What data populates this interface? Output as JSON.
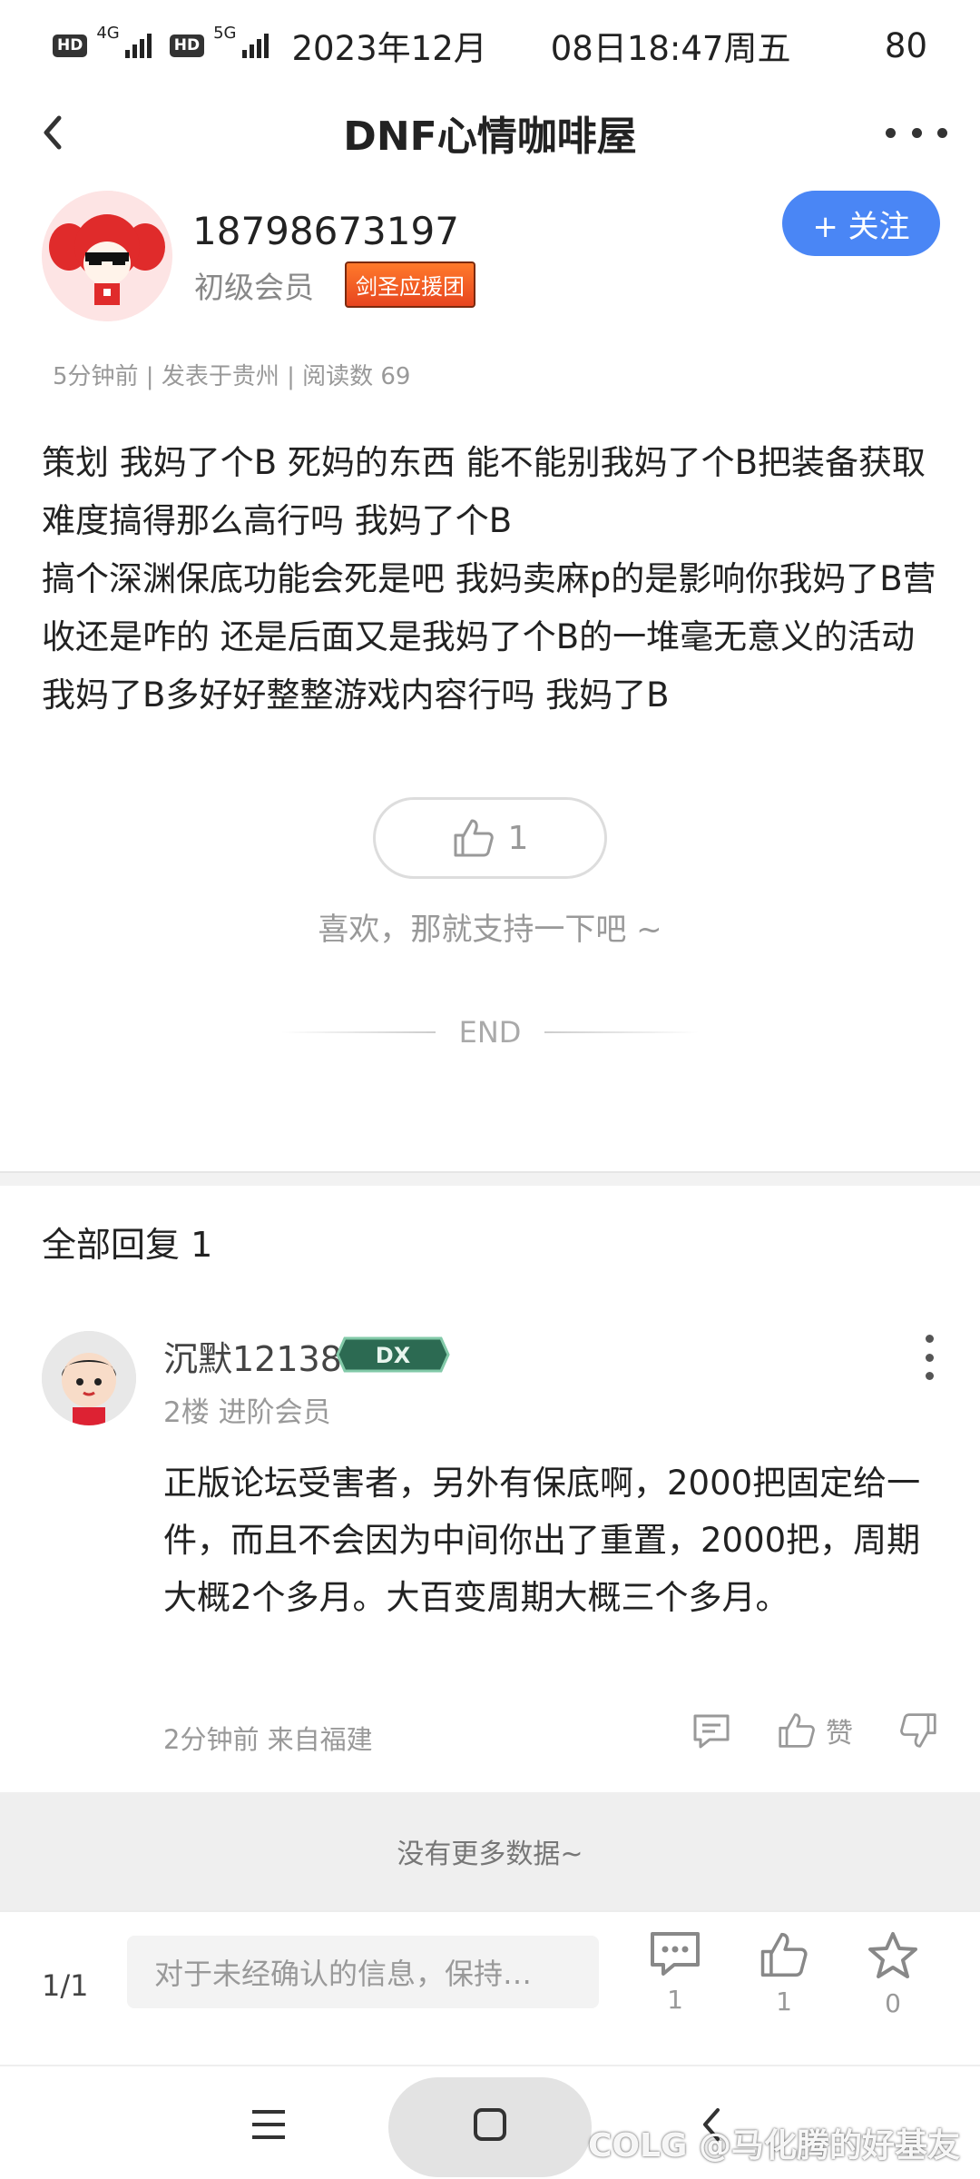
{
  "status_bar": {
    "hd1": "HD",
    "net1": "4G",
    "hd2": "HD",
    "net2": "5G",
    "date": "2023年12月",
    "time": "08日18:47周五",
    "battery": "80"
  },
  "header": {
    "title": "DNF心情咖啡屋",
    "back_icon": "chevron-left-icon",
    "more_icon": "more-horizontal-icon"
  },
  "author": {
    "name": "18798673197",
    "level": "初级会员",
    "badge": "剑圣应援团",
    "follow_label": "+ 关注"
  },
  "post": {
    "meta": "5分钟前 | 发表于贵州 | 阅读数 69",
    "body": "策划 我妈了个B 死妈的东西 能不能别我妈了个B把装备获取难度搞得那么高行吗 我妈了个B\n搞个深渊保底功能会死是吧 我妈卖麻p的是影响你我妈了B营收还是咋的 还是后面又是我妈了个B的一堆毫无意义的活动 我妈了B多好好整整游戏内容行吗 我妈了B",
    "like_count": "1",
    "like_hint": "喜欢，那就支持一下吧 ~",
    "end_label": "END"
  },
  "replies": {
    "title": "全部回复 1",
    "items": [
      {
        "user": "沉默12138",
        "badge_text": "DX",
        "sub": "2楼 进阶会员",
        "body": "正版论坛受害者，另外有保底啊，2000把固定给一件，而且不会因为中间你出了重置，2000把，周期大概2个多月。大百变周期大概三个多月。",
        "foot": "2分钟前 来自福建",
        "like_label": "赞"
      }
    ],
    "no_more": "没有更多数据~"
  },
  "bottom_bar": {
    "page": "1/1",
    "input_placeholder": "对于未经确认的信息，保持…",
    "comment_count": "1",
    "like_count": "1",
    "fav_count": "0"
  },
  "watermark": "COLG @马化腾的好基友",
  "colors": {
    "accent": "#4a86f5",
    "badge": "#e7451f"
  }
}
